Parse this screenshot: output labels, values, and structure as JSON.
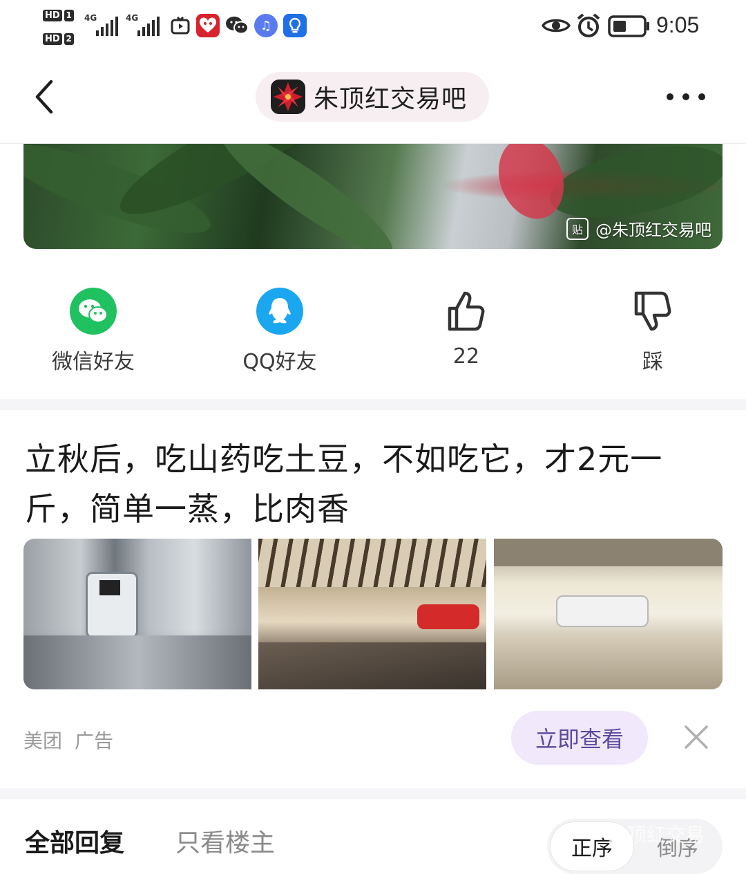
{
  "status_bar": {
    "sim1": "HD",
    "sim1_num": "1",
    "sim2": "HD",
    "sim2_num": "2",
    "net1": "4G",
    "net2": "4G",
    "time": "9:05"
  },
  "nav": {
    "forum_name": "朱顶红交易吧"
  },
  "post_image": {
    "watermark": "@朱顶红交易吧",
    "watermark_icon": "贴"
  },
  "actions": [
    {
      "label": "微信好友",
      "icon": "wechat-icon",
      "color": "#1fc160"
    },
    {
      "label": "QQ好友",
      "icon": "qq-icon",
      "color": "#1aa7f0"
    },
    {
      "label": "22",
      "icon": "thumbs-up-icon"
    },
    {
      "label": "踩",
      "icon": "thumbs-down-icon"
    }
  ],
  "ad": {
    "title": "立秋后，吃山药吃土豆，不如吃它，才2元一斤，简单一蒸，比肉香",
    "source": "美团",
    "tag": "广告",
    "cta": "立即查看"
  },
  "replies": {
    "tab_all": "全部回复",
    "tab_op": "只看楼主",
    "sort_asc": "正序",
    "sort_desc": "倒序",
    "overlay_watermark": "朱顶红交易"
  },
  "colors": {
    "pill_bg": "#f6eef0",
    "cta_bg": "#f1e8fb",
    "cta_text": "#5b4a9e"
  }
}
